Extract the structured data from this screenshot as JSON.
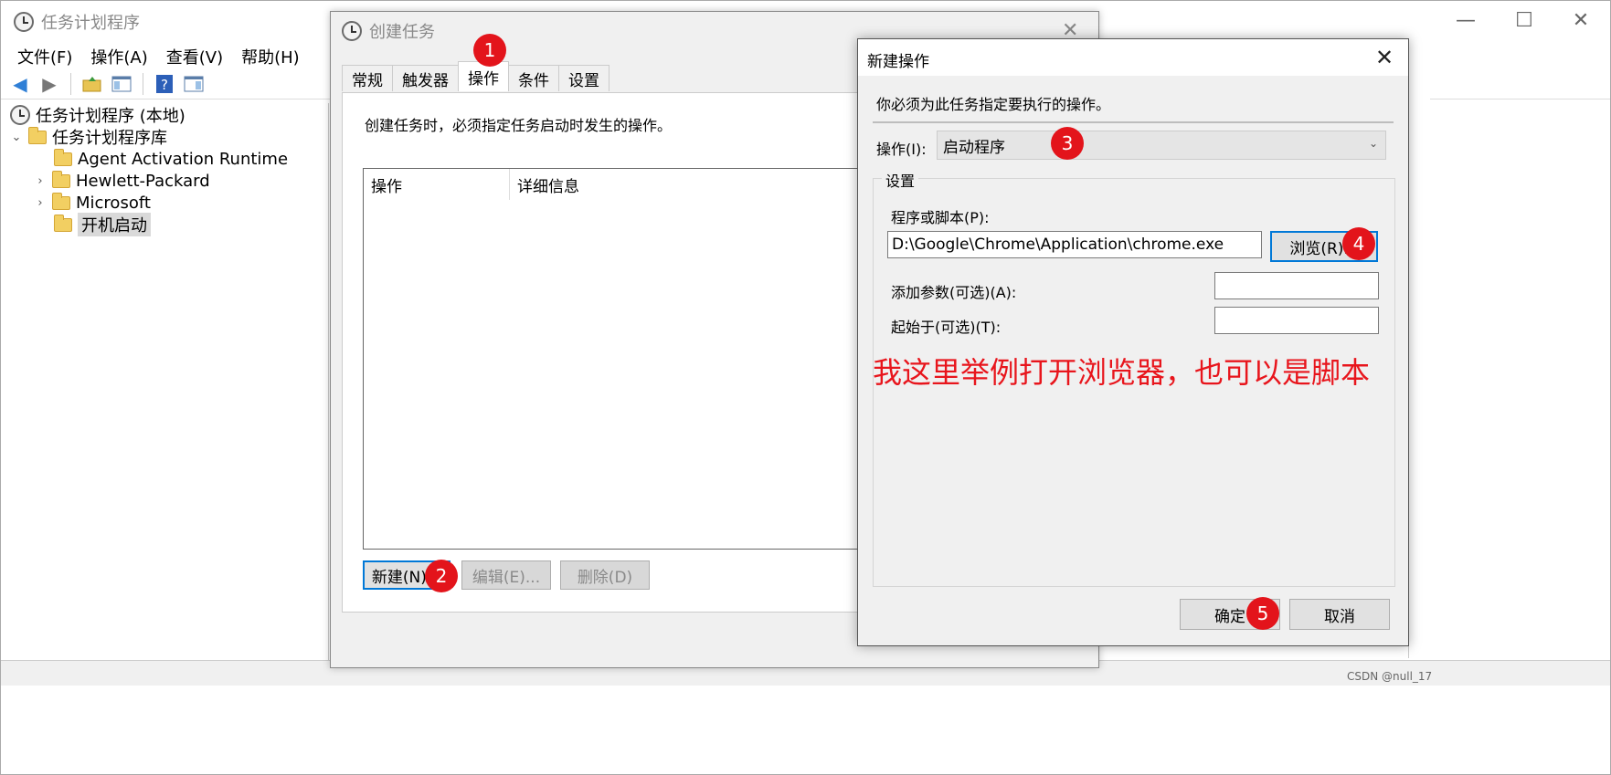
{
  "main_window": {
    "title": "任务计划程序",
    "controls": {
      "minimize": "—",
      "maximize": "☐",
      "close": "✕"
    },
    "menu": [
      "文件(F)",
      "操作(A)",
      "查看(V)",
      "帮助(H)"
    ]
  },
  "tree": {
    "root": "任务计划程序 (本地)",
    "library": "任务计划程序库",
    "items": [
      "Agent Activation Runtime",
      "Hewlett-Packard",
      "Microsoft",
      "开机启动"
    ]
  },
  "task_dialog": {
    "title": "创建任务",
    "tabs": [
      "常规",
      "触发器",
      "操作",
      "条件",
      "设置"
    ],
    "active_tab": "操作",
    "description": "创建任务时，必须指定任务启动时发生的操作。",
    "columns": [
      "操作",
      "详细信息"
    ],
    "buttons": {
      "new": "新建(N)...",
      "edit": "编辑(E)...",
      "delete": "删除(D)"
    }
  },
  "action_dialog": {
    "title": "新建操作",
    "description": "你必须为此任务指定要执行的操作。",
    "action_label": "操作(I):",
    "action_value": "启动程序",
    "settings_legend": "设置",
    "program_label": "程序或脚本(P):",
    "program_value": "D:\\Google\\Chrome\\Application\\chrome.exe",
    "browse_button": "浏览(R)...",
    "args_label": "添加参数(可选)(A):",
    "args_value": "",
    "start_in_label": "起始于(可选)(T):",
    "start_in_value": "",
    "annotation": "我这里举例打开浏览器，也可以是脚本",
    "ok_button": "确定",
    "cancel_button": "取消"
  },
  "markers": [
    "1",
    "2",
    "3",
    "4",
    "5"
  ],
  "watermark": "CSDN @null_17",
  "colors": {
    "marker_red": "#e3141b",
    "annotation_red": "#e8151c",
    "focus_blue": "#0078d7"
  }
}
